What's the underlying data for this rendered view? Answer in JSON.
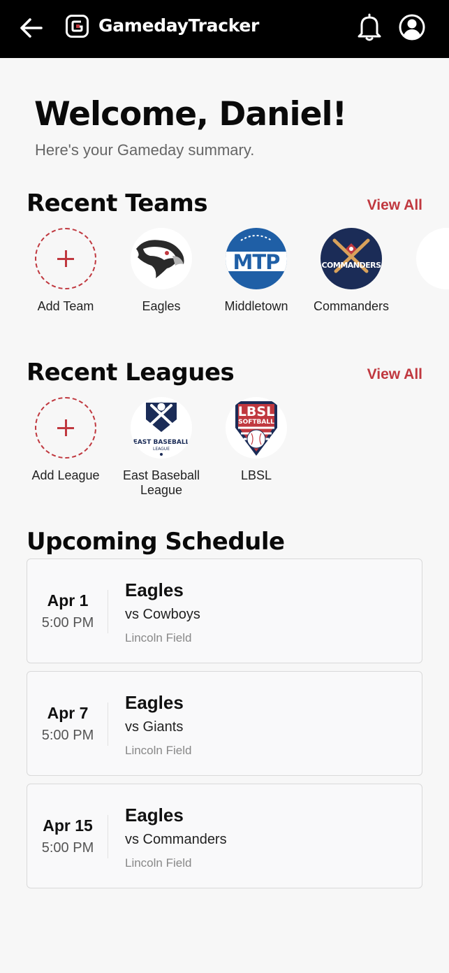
{
  "header": {
    "app_title": "GamedayTracker",
    "icons": {
      "back": "back-arrow-icon",
      "logo": "app-logo-icon",
      "notifications": "bell-icon",
      "profile": "profile-icon"
    }
  },
  "welcome": {
    "title": "Welcome, Daniel!",
    "subtitle": "Here's your Gameday summary."
  },
  "teams": {
    "title": "Recent Teams",
    "view_all": "View All",
    "add_label": "Add Team",
    "items": [
      {
        "label": "Eagles",
        "logo": "eagle-logo"
      },
      {
        "label": "Middletown",
        "logo_text": "MTP"
      },
      {
        "label": "Commanders",
        "logo_text": "COMMANDERS"
      }
    ]
  },
  "leagues": {
    "title": "Recent Leagues",
    "view_all": "View All",
    "add_label": "Add League",
    "items": [
      {
        "label": "East Baseball League",
        "logo_text": "EAST BASEBALL",
        "logo_subtext": "LEAGUE"
      },
      {
        "label": "LBSL",
        "logo_text": "LBSL",
        "logo_subtext": "SOFTBALL"
      }
    ]
  },
  "schedule": {
    "title": "Upcoming Schedule",
    "games": [
      {
        "date": "Apr 1",
        "time": "5:00 PM",
        "team": "Eagles",
        "opponent": "vs Cowboys",
        "location": "Lincoln Field"
      },
      {
        "date": "Apr 7",
        "time": "5:00 PM",
        "team": "Eagles",
        "opponent": "vs Giants",
        "location": "Lincoln Field"
      },
      {
        "date": "Apr 15",
        "time": "5:00 PM",
        "team": "Eagles",
        "opponent": "vs Commanders",
        "location": "Lincoln Field"
      }
    ]
  },
  "colors": {
    "accent": "#c0383f",
    "header_bg": "#000000",
    "navy": "#1b2c57",
    "mtp_blue": "#1f5fa6"
  }
}
